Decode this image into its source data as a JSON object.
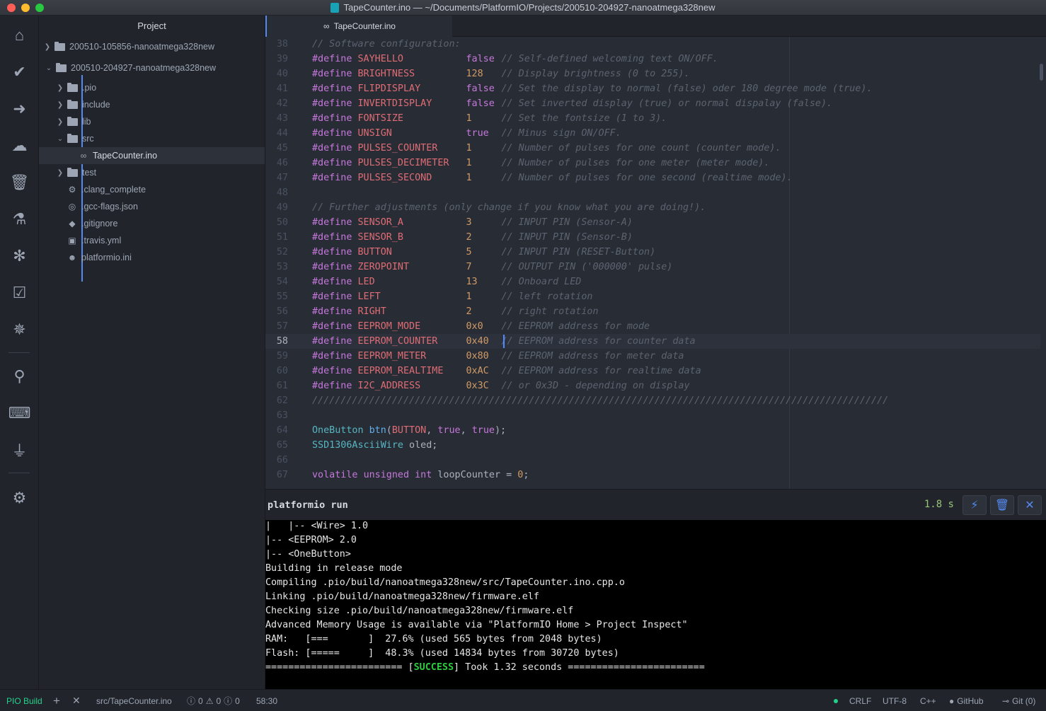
{
  "window": {
    "title": "TapeCounter.ino — ~/Documents/PlatformIO/Projects/200510-204927-nanoatmega328new"
  },
  "iconbar": {
    "icons": [
      "home-icon",
      "check-icon",
      "arrow-right-icon",
      "cloud-upload-icon",
      "trash-icon",
      "flask-icon",
      "bug-icon",
      "checklist-icon",
      "compass-icon",
      "search-icon",
      "terminal-icon",
      "plug-icon",
      "gear-icon"
    ]
  },
  "tree": {
    "header": "Project",
    "items": [
      {
        "label": "200510-105856-nanoatmega328new",
        "type": "folder",
        "expanded": false
      },
      {
        "label": "200510-204927-nanoatmega328new",
        "type": "folder",
        "expanded": true
      },
      {
        "label": ".pio",
        "type": "folder"
      },
      {
        "label": "include",
        "type": "folder"
      },
      {
        "label": "lib",
        "type": "folder"
      },
      {
        "label": "src",
        "type": "folder",
        "expanded": true
      },
      {
        "label": "TapeCounter.ino",
        "type": "file",
        "selected": true
      },
      {
        "label": "test",
        "type": "folder"
      },
      {
        "label": ".clang_complete",
        "type": "file"
      },
      {
        "label": ".gcc-flags.json",
        "type": "file"
      },
      {
        "label": ".gitignore",
        "type": "file"
      },
      {
        "label": ".travis.yml",
        "type": "file"
      },
      {
        "label": "platformio.ini",
        "type": "file"
      }
    ]
  },
  "editor": {
    "tab": "TapeCounter.ino",
    "current_line": "58",
    "lines": [
      {
        "n": "38",
        "cm": "// Software configuration:"
      },
      {
        "n": "39",
        "kw": "#define",
        "mac": "SAYHELLO",
        "val": "false",
        "cm": "// Self-defined welcoming text ON/OFF."
      },
      {
        "n": "40",
        "kw": "#define",
        "mac": "BRIGHTNESS",
        "val": "128",
        "cm": "// Display brightness (0 to 255)."
      },
      {
        "n": "41",
        "kw": "#define",
        "mac": "FLIPDISPLAY",
        "val": "false",
        "cm": "// Set the display to normal (false) oder 180 degree mode (true)."
      },
      {
        "n": "42",
        "kw": "#define",
        "mac": "INVERTDISPLAY",
        "val": "false",
        "cm": "// Set inverted display (true) or normal dispalay (false)."
      },
      {
        "n": "43",
        "kw": "#define",
        "mac": "FONTSIZE",
        "val": "1",
        "cm": "// Set the fontsize (1 to 3)."
      },
      {
        "n": "44",
        "kw": "#define",
        "mac": "UNSIGN",
        "val": "true",
        "cm": "// Minus sign ON/OFF."
      },
      {
        "n": "45",
        "kw": "#define",
        "mac": "PULSES_COUNTER",
        "val": "1",
        "cm": "// Number of pulses for one count (counter mode)."
      },
      {
        "n": "46",
        "kw": "#define",
        "mac": "PULSES_DECIMETER",
        "val": "1",
        "cm": "// Number of pulses for one meter (meter mode)."
      },
      {
        "n": "47",
        "kw": "#define",
        "mac": "PULSES_SECOND",
        "val": "1",
        "cm": "// Number of pulses for one second (realtime mode)."
      },
      {
        "n": "48"
      },
      {
        "n": "49",
        "cm": "// Further adjustments (only change if you know what you are doing!)."
      },
      {
        "n": "50",
        "kw": "#define",
        "mac": "SENSOR_A",
        "val": "3",
        "cm": "// INPUT PIN (Sensor-A)"
      },
      {
        "n": "51",
        "kw": "#define",
        "mac": "SENSOR_B",
        "val": "2",
        "cm": "// INPUT PIN (Sensor-B)"
      },
      {
        "n": "52",
        "kw": "#define",
        "mac": "BUTTON",
        "val": "5",
        "cm": "// INPUT PIN (RESET-Button)"
      },
      {
        "n": "53",
        "kw": "#define",
        "mac": "ZEROPOINT",
        "val": "7",
        "cm": "// OUTPUT PIN ('000000' pulse)"
      },
      {
        "n": "54",
        "kw": "#define",
        "mac": "LED",
        "val": "13",
        "cm": "// Onboard LED"
      },
      {
        "n": "55",
        "kw": "#define",
        "mac": "LEFT",
        "val": "1",
        "cm": "// left rotation"
      },
      {
        "n": "56",
        "kw": "#define",
        "mac": "RIGHT",
        "val": "2",
        "cm": "// right rotation"
      },
      {
        "n": "57",
        "kw": "#define",
        "mac": "EEPROM_MODE",
        "val": "0x0",
        "cm": "// EEPROM address for mode"
      },
      {
        "n": "58",
        "kw": "#define",
        "mac": "EEPROM_COUNTER",
        "val": "0x40",
        "cm": "// EEPROM address for counter data"
      },
      {
        "n": "59",
        "kw": "#define",
        "mac": "EEPROM_METER",
        "val": "0x80",
        "cm": "// EEPROM address for meter data"
      },
      {
        "n": "60",
        "kw": "#define",
        "mac": "EEPROM_REALTIME",
        "val": "0xAC",
        "cm": "// EEPROM address for realtime data"
      },
      {
        "n": "61",
        "kw": "#define",
        "mac": "I2C_ADDRESS",
        "val": "0x3C",
        "cm": "// or 0x3D - depending on display"
      },
      {
        "n": "62",
        "cm": "/////////////////////////////////////////////////////////////////////////////////////////////////////"
      },
      {
        "n": "63"
      },
      {
        "n": "64",
        "code": [
          [
            "ty",
            "OneButton"
          ],
          [
            "tx",
            " "
          ],
          [
            "fn",
            "btn"
          ],
          [
            "tx",
            "("
          ],
          [
            "mac",
            "BUTTON"
          ],
          [
            "tx",
            ", "
          ],
          [
            "kw",
            "true"
          ],
          [
            "tx",
            ", "
          ],
          [
            "kw",
            "true"
          ],
          [
            "tx",
            ");"
          ]
        ]
      },
      {
        "n": "65",
        "code": [
          [
            "ty",
            "SSD1306AsciiWire"
          ],
          [
            "tx",
            " oled;"
          ]
        ]
      },
      {
        "n": "66"
      },
      {
        "n": "67",
        "code": [
          [
            "kw",
            "volatile"
          ],
          [
            "tx",
            " "
          ],
          [
            "kw",
            "unsigned"
          ],
          [
            "tx",
            " "
          ],
          [
            "kw",
            "int"
          ],
          [
            "tx",
            " loopCounter = "
          ],
          [
            "num",
            "0"
          ],
          [
            "tx",
            ";"
          ]
        ]
      }
    ]
  },
  "terminal": {
    "title": "platformio run",
    "time": "1.8 s",
    "lines": [
      "|   |-- <Wire> 1.0",
      "|-- <EEPROM> 2.0",
      "|-- <OneButton>",
      "Building in release mode",
      "Compiling .pio/build/nanoatmega328new/src/TapeCounter.ino.cpp.o",
      "Linking .pio/build/nanoatmega328new/firmware.elf",
      "Checking size .pio/build/nanoatmega328new/firmware.elf",
      "Advanced Memory Usage is available via \"PlatformIO Home > Project Inspect\"",
      "RAM:   [===       ]  27.6% (used 565 bytes from 2048 bytes)",
      "Flash: [=====     ]  48.3% (used 14834 bytes from 30720 bytes)"
    ],
    "success_prefix": "======================== [",
    "success_word": "SUCCESS",
    "success_suffix": "] Took 1.32 seconds ========================"
  },
  "statusbar": {
    "build": "PIO Build",
    "file": "src/TapeCounter.ino",
    "errors": "0",
    "warnings": "0",
    "infos": "0",
    "cursor": "58:30",
    "line_ending": "CRLF",
    "encoding": "UTF-8",
    "grammar": "C++",
    "github": "GitHub",
    "git": "Git (0)"
  },
  "colors": {
    "accent": "#568af2",
    "success": "#23d18b"
  }
}
